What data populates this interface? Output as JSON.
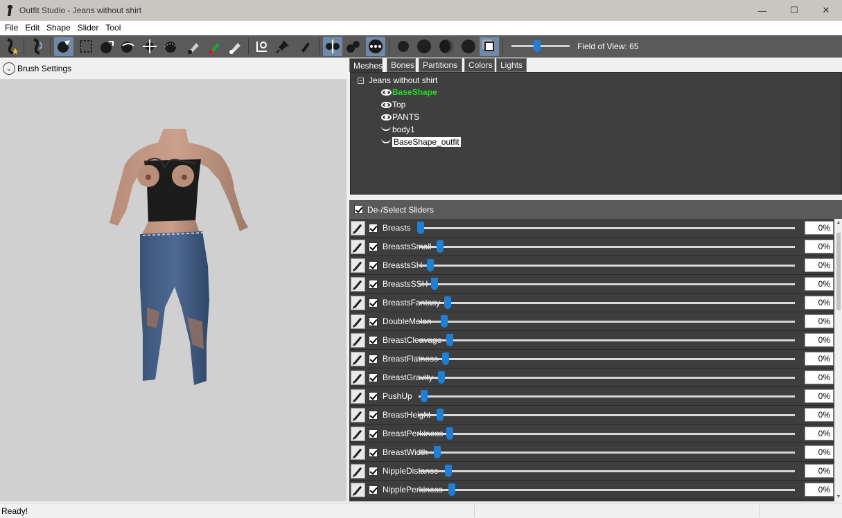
{
  "window": {
    "title": "Outfit Studio - Jeans without shirt",
    "minimize": "—",
    "maximize": "☐",
    "close": "✕"
  },
  "menu": [
    "File",
    "Edit",
    "Shape",
    "Slider",
    "Tool"
  ],
  "toolbar": {
    "fov_label": "Field of View: 65",
    "fov_value": 65
  },
  "left_panel": {
    "header": "Brush Settings"
  },
  "tabs": [
    "Meshes",
    "Bones",
    "Partitions",
    "Colors",
    "Lights"
  ],
  "active_tab": "Meshes",
  "tree": {
    "root": "Jeans without shirt",
    "items": [
      {
        "label": "BaseShape",
        "icon": "eye-icon",
        "style": "active"
      },
      {
        "label": "Top",
        "icon": "eye-icon",
        "style": "normal"
      },
      {
        "label": "PANTS",
        "icon": "eye-icon",
        "style": "normal"
      },
      {
        "label": "body1",
        "icon": "hidden-icon",
        "style": "normal"
      },
      {
        "label": "BaseShape_outfit",
        "icon": "hidden-icon",
        "style": "selected"
      }
    ]
  },
  "sliders_header": "De-/Select Sliders",
  "sliders": [
    {
      "name": "Breasts",
      "value": "0%",
      "pos": 0.005
    },
    {
      "name": "BreastsSmall",
      "value": "0%",
      "pos": 0.058
    },
    {
      "name": "BreastsSH",
      "value": "0%",
      "pos": 0.032
    },
    {
      "name": "BreastsSSH",
      "value": "0%",
      "pos": 0.043
    },
    {
      "name": "BreastsFantasy",
      "value": "0%",
      "pos": 0.078
    },
    {
      "name": "DoubleMelon",
      "value": "0%",
      "pos": 0.069
    },
    {
      "name": "BreastCleavage",
      "value": "0%",
      "pos": 0.082
    },
    {
      "name": "BreastFlatness",
      "value": "0%",
      "pos": 0.071
    },
    {
      "name": "BreastGravity",
      "value": "0%",
      "pos": 0.06
    },
    {
      "name": "PushUp",
      "value": "0%",
      "pos": 0.014
    },
    {
      "name": "BreastHeight",
      "value": "0%",
      "pos": 0.058
    },
    {
      "name": "BreastPerkiness",
      "value": "0%",
      "pos": 0.082
    },
    {
      "name": "BreastWidth",
      "value": "0%",
      "pos": 0.05
    },
    {
      "name": "NippleDistance",
      "value": "0%",
      "pos": 0.08
    },
    {
      "name": "NipplePerkiness",
      "value": "0%",
      "pos": 0.089
    }
  ],
  "status": "Ready!"
}
